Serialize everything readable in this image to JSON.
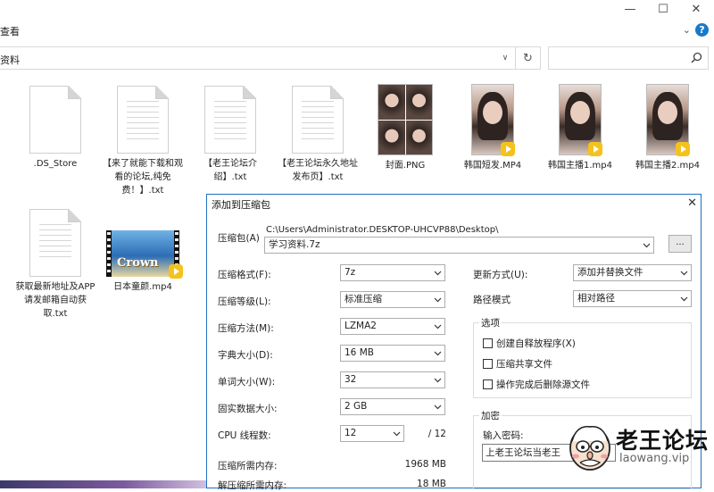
{
  "window": {
    "min": "—",
    "max": "☐",
    "close": "✕"
  },
  "ribbon": {
    "tab": "查看",
    "help": "?"
  },
  "address": {
    "path": "资料"
  },
  "search": {
    "placeholder": ""
  },
  "files": [
    {
      "name": ".DS_Store",
      "kind": "doc"
    },
    {
      "name": "【来了就能下载和观看的论坛,纯免费！】.txt",
      "kind": "doc"
    },
    {
      "name": "【老王论坛介绍】.txt",
      "kind": "doc"
    },
    {
      "name": "【老王论坛永久地址发布页】.txt",
      "kind": "doc"
    },
    {
      "name": "封面.PNG",
      "kind": "collage"
    },
    {
      "name": "韩国短发.MP4",
      "kind": "photo"
    },
    {
      "name": "韩国主播1.mp4",
      "kind": "photo"
    },
    {
      "name": "韩国主播2.mp4",
      "kind": "photo"
    },
    {
      "name": "获取最新地址及APP请发邮箱自动获取.txt",
      "kind": "doc"
    },
    {
      "name": "日本童颜.mp4",
      "kind": "video",
      "thumb_text": "Crown"
    }
  ],
  "dialog": {
    "title": "添加到压缩包",
    "archive_label": "压缩包(A)",
    "archive_dir": "C:\\Users\\Administrator.DESKTOP-UHCVP88\\Desktop\\",
    "archive_name": "学习资料.7z",
    "browse": "...",
    "format_label": "压缩格式(F):",
    "format_value": "7z",
    "level_label": "压缩等级(L):",
    "level_value": "标准压缩",
    "method_label": "压缩方法(M):",
    "method_value": "LZMA2",
    "dict_label": "字典大小(D):",
    "dict_value": "16 MB",
    "word_label": "单词大小(W):",
    "word_value": "32",
    "solid_label": "固实数据大小:",
    "solid_value": "2 GB",
    "threads_label": "CPU 线程数:",
    "threads_value": "12",
    "threads_max": "/ 12",
    "mem_comp_label": "压缩所需内存:",
    "mem_comp_value": "1968 MB",
    "mem_decomp_label": "解压缩所需内存:",
    "mem_decomp_value": "18 MB",
    "update_label": "更新方式(U):",
    "update_value": "添加并替换文件",
    "path_label": "路径模式",
    "path_value": "相对路径",
    "options_title": "选项",
    "opt_sfx": "创建自释放程序(X)",
    "opt_shared": "压缩共享文件",
    "opt_delete": "操作完成后删除源文件",
    "encrypt_title": "加密",
    "password_label": "输入密码:",
    "password_value": "上老王论坛当老王"
  },
  "watermark": {
    "brand": "老王论坛",
    "url": "laowang.vip"
  }
}
